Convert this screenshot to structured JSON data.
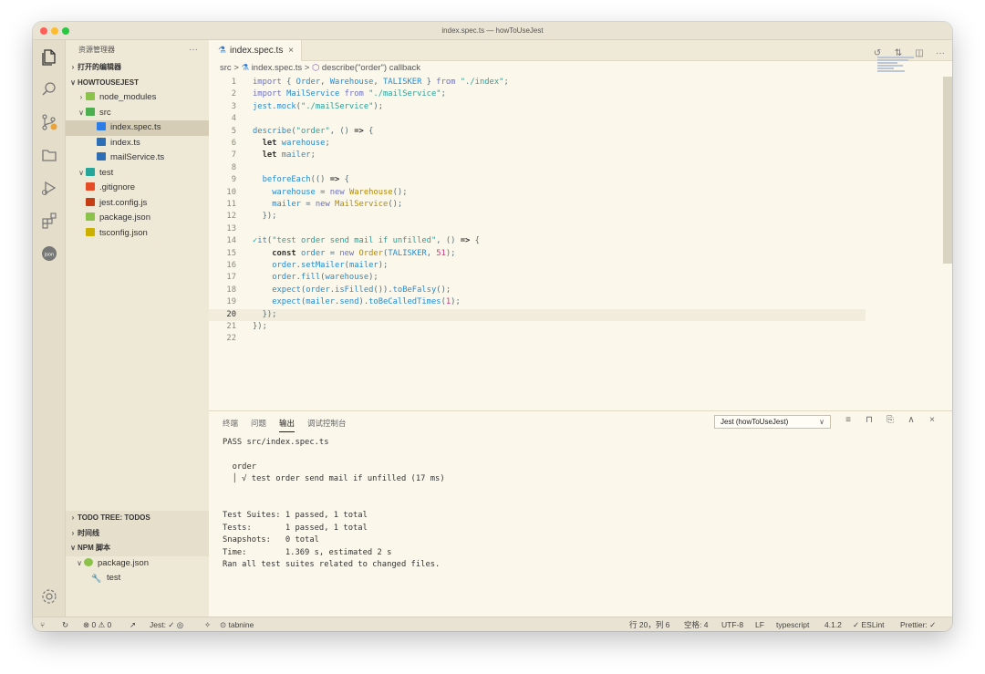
{
  "window": {
    "title": "index.spec.ts — howToUseJest"
  },
  "activity_bar": {
    "icons": [
      "files-icon",
      "search-icon",
      "source-control-icon",
      "folder-icon",
      "run-debug-icon",
      "extensions-icon",
      "json-icon",
      "settings-icon"
    ],
    "json_label": "json"
  },
  "sidebar": {
    "header": "资源管理器",
    "more": "···",
    "open_editors": "打开的编辑器",
    "project": "HOWTOUSEJEST",
    "tree": [
      {
        "label": "node_modules",
        "icon": "folder-node-icon",
        "color": "#8bc34a",
        "indent": 1,
        "chev": ">"
      },
      {
        "label": "src",
        "icon": "folder-src-icon",
        "color": "#4caf50",
        "indent": 1,
        "chev": "∨"
      },
      {
        "label": "index.spec.ts",
        "icon": "test-flask-icon",
        "color": "#2d7be5",
        "indent": 2,
        "chev": ""
      },
      {
        "label": "index.ts",
        "icon": "typescript-icon",
        "color": "#2d6fb7",
        "indent": 2,
        "chev": ""
      },
      {
        "label": "mailService.ts",
        "icon": "typescript-icon",
        "color": "#2d6fb7",
        "indent": 2,
        "chev": ""
      },
      {
        "label": "test",
        "icon": "folder-test-icon",
        "color": "#26a69a",
        "indent": 1,
        "chev": "∨"
      },
      {
        "label": ".gitignore",
        "icon": "git-icon",
        "color": "#e44d26",
        "indent": 1,
        "chev": ""
      },
      {
        "label": "jest.config.js",
        "icon": "jest-icon",
        "color": "#c63d14",
        "indent": 1,
        "chev": ""
      },
      {
        "label": "package.json",
        "icon": "npm-icon",
        "color": "#8bc34a",
        "indent": 1,
        "chev": ""
      },
      {
        "label": "tsconfig.json",
        "icon": "braces-icon",
        "color": "#cbb000",
        "indent": 1,
        "chev": ""
      }
    ],
    "todo_tree": "TODO TREE: TODOS",
    "timeline": "时间线",
    "npm_scripts": "NPM 脚本",
    "npm_package": "package.json",
    "npm_test": "test"
  },
  "editor": {
    "tab_label": "index.spec.ts",
    "tab_close": "×",
    "breadcrumb": [
      "src",
      ">",
      "index.spec.ts",
      ">",
      "describe(\"order\") callback"
    ],
    "current_line": 20
  },
  "panel": {
    "tabs": [
      "终端",
      "问题",
      "输出",
      "调试控制台"
    ],
    "active_tab": "输出",
    "output_channel": "Jest (howToUseJest)",
    "output_lines": [
      "PASS src/index.spec.ts",
      "",
      "  order",
      "  │ √ test order send mail if unfilled (17 ms)",
      "",
      "",
      "Test Suites: 1 passed, 1 total",
      "Tests:       1 passed, 1 total",
      "Snapshots:   0 total",
      "Time:        1.369 s, estimated 2 s",
      "Ran all test suites related to changed files."
    ]
  },
  "statusbar": {
    "problems": "⊗ 0 ⚠ 0",
    "jest": "Jest: ✓ ◎",
    "tabnine": "tabnine",
    "position": "行 20，列 6",
    "spaces": "空格: 4",
    "encoding": "UTF-8",
    "eol": "LF",
    "language": "typescript",
    "version": "4.1.2",
    "eslint": "✓ ESLint",
    "prettier": "Prettier: ✓"
  },
  "colors": {
    "accent": "#2d7be5",
    "background": "#fbf7ea",
    "sidebar": "#eee8d6"
  }
}
